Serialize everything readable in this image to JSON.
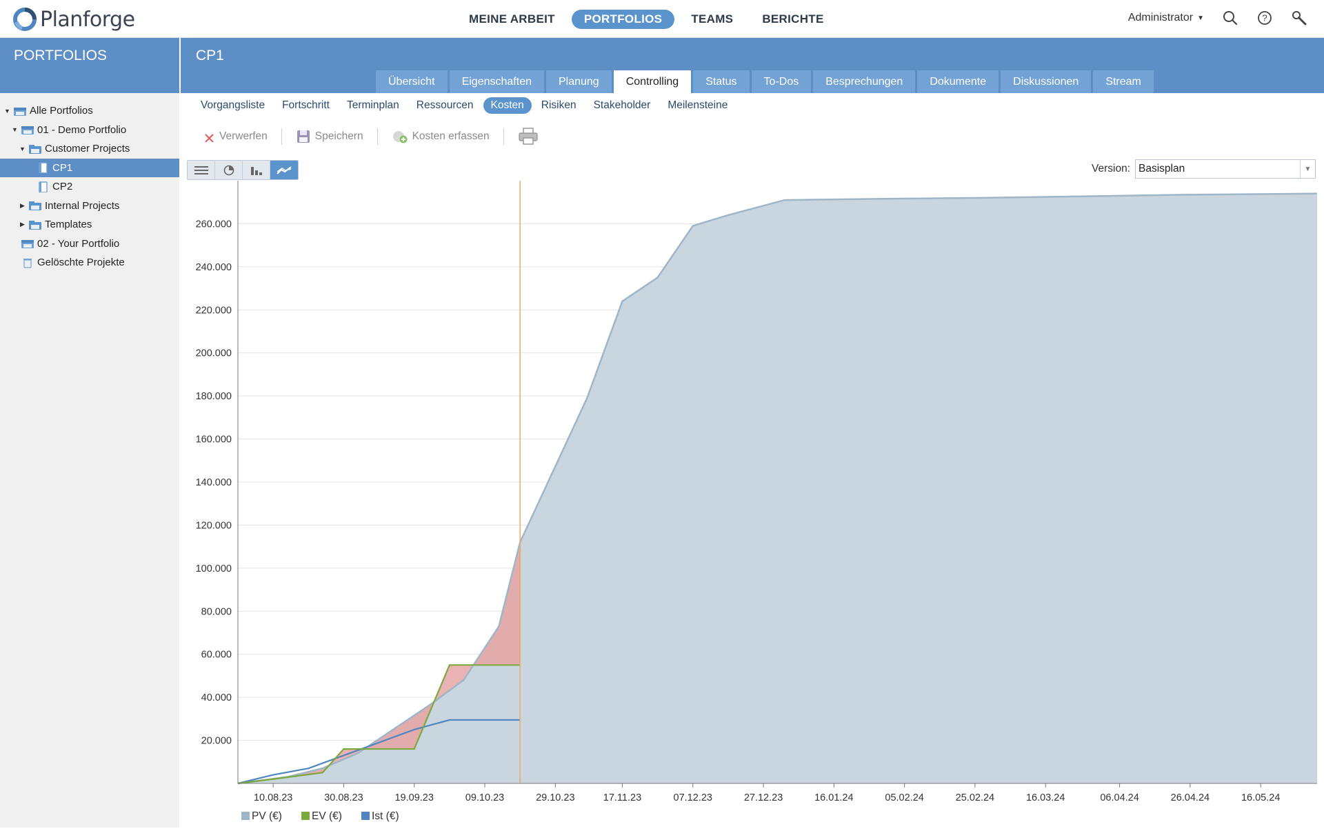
{
  "app": {
    "logo_text": "Planforge"
  },
  "topnav": [
    {
      "label": "MEINE ARBEIT",
      "active": false
    },
    {
      "label": "PORTFOLIOS",
      "active": true
    },
    {
      "label": "TEAMS",
      "active": false
    },
    {
      "label": "BERICHTE",
      "active": false
    }
  ],
  "user": {
    "name": "Administrator"
  },
  "sidebar": {
    "title": "PORTFOLIOS",
    "tree": [
      {
        "label": "Alle Portfolios",
        "level": 0,
        "toggle": "open",
        "icon": "portfolio-icon"
      },
      {
        "label": "01 - Demo Portfolio",
        "level": 1,
        "toggle": "open",
        "icon": "portfolio-icon"
      },
      {
        "label": "Customer Projects",
        "level": 2,
        "toggle": "open",
        "icon": "folder-icon"
      },
      {
        "label": "CP1",
        "level": 3,
        "toggle": "",
        "icon": "project-icon",
        "selected": true
      },
      {
        "label": "CP2",
        "level": 3,
        "toggle": "",
        "icon": "project-icon"
      },
      {
        "label": "Internal Projects",
        "level": 2,
        "toggle": "closed",
        "icon": "folder-icon"
      },
      {
        "label": "Templates",
        "level": 2,
        "toggle": "closed",
        "icon": "folder-icon"
      },
      {
        "label": "02 - Your Portfolio",
        "level": 1,
        "toggle": "",
        "icon": "portfolio-icon"
      },
      {
        "label": "Gelöschte Projekte",
        "level": 1,
        "toggle": "",
        "icon": "trash-icon"
      }
    ]
  },
  "content": {
    "title": "CP1",
    "tabs": [
      "Übersicht",
      "Eigenschaften",
      "Planung",
      "Controlling",
      "Status",
      "To-Dos",
      "Besprechungen",
      "Dokumente",
      "Diskussionen",
      "Stream"
    ],
    "active_tab": "Controlling",
    "subtabs": [
      "Vorgangsliste",
      "Fortschritt",
      "Terminplan",
      "Ressourcen",
      "Kosten",
      "Risiken",
      "Stakeholder",
      "Meilensteine"
    ],
    "active_subtab": "Kosten",
    "toolbar": {
      "discard": "Verwerfen",
      "save": "Speichern",
      "record_costs": "Kosten erfassen"
    },
    "version_label": "Version:",
    "version_value": "Basisplan"
  },
  "chart_data": {
    "type": "area",
    "x_ticks": [
      "10.08.23",
      "30.08.23",
      "19.09.23",
      "09.10.23",
      "29.10.23",
      "17.11.23",
      "07.12.23",
      "27.12.23",
      "16.01.24",
      "05.02.24",
      "25.02.24",
      "16.03.24",
      "06.04.24",
      "26.04.24",
      "16.05.24"
    ],
    "y_ticks": [
      "20.000",
      "40.000",
      "60.000",
      "80.000",
      "100.000",
      "120.000",
      "140.000",
      "160.000",
      "180.000",
      "200.000",
      "220.000",
      "240.000",
      "260.000"
    ],
    "ylim": [
      0,
      280000
    ],
    "x_range": [
      "31.07.23",
      "01.06.24"
    ],
    "status_date": "19.10.23",
    "grid": true,
    "legend_position": "bottom-left",
    "series": [
      {
        "name": "PV (€)",
        "color": "#9fb6c8",
        "fill": "#c9d6df",
        "points": [
          [
            "31.07.23",
            0
          ],
          [
            "14.08.23",
            3000
          ],
          [
            "24.08.23",
            7000
          ],
          [
            "03.09.23",
            14000
          ],
          [
            "13.09.23",
            25000
          ],
          [
            "23.09.23",
            36000
          ],
          [
            "03.10.23",
            48000
          ],
          [
            "13.10.23",
            73000
          ],
          [
            "19.10.23",
            112000
          ],
          [
            "07.11.23",
            179000
          ],
          [
            "17.11.23",
            224000
          ],
          [
            "27.11.23",
            235000
          ],
          [
            "07.12.23",
            259000
          ],
          [
            "17.12.23",
            264000
          ],
          [
            "02.01.24",
            271000
          ],
          [
            "26.01.24",
            271500
          ],
          [
            "25.02.24",
            272000
          ],
          [
            "06.04.24",
            273000
          ],
          [
            "26.04.24",
            273500
          ],
          [
            "01.06.24",
            274000
          ]
        ]
      },
      {
        "name": "EV (€)",
        "color": "#7da83b",
        "points": [
          [
            "31.07.23",
            0
          ],
          [
            "10.08.23",
            2000
          ],
          [
            "24.08.23",
            5000
          ],
          [
            "30.08.23",
            16000
          ],
          [
            "19.09.23",
            16000
          ],
          [
            "29.09.23",
            55000
          ],
          [
            "19.10.23",
            55000
          ]
        ]
      },
      {
        "name": "Ist (€)",
        "color": "#4f86c2",
        "points": [
          [
            "31.07.23",
            0
          ],
          [
            "10.08.23",
            4000
          ],
          [
            "20.08.23",
            7000
          ],
          [
            "30.08.23",
            13000
          ],
          [
            "09.09.23",
            19000
          ],
          [
            "19.09.23",
            25000
          ],
          [
            "29.09.23",
            29500
          ],
          [
            "19.10.23",
            29500
          ]
        ]
      }
    ]
  }
}
